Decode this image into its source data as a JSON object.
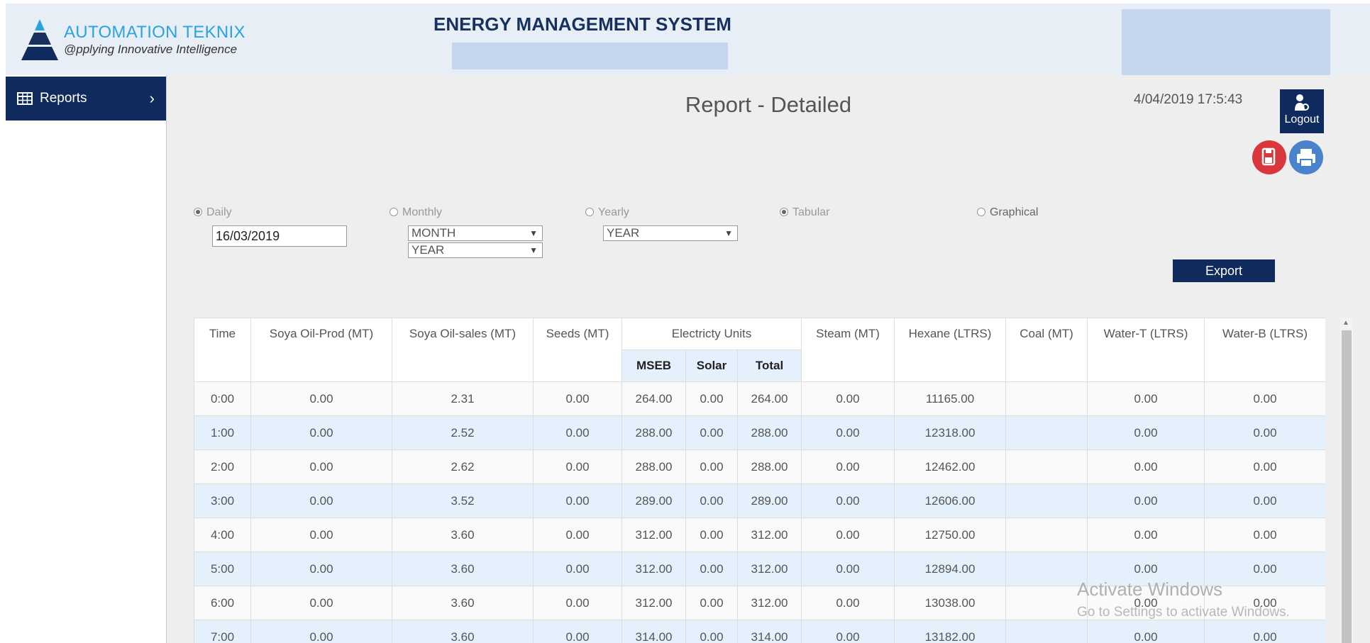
{
  "header": {
    "brand_name": "AUTOMATION TEKNIX",
    "brand_tagline": "@pplying Innovative Intelligence",
    "app_title": "ENERGY MANAGEMENT SYSTEM"
  },
  "sidebar": {
    "items": [
      {
        "label": "Reports",
        "icon": "table-icon",
        "chevron": "›"
      }
    ]
  },
  "main": {
    "page_title": "Report - Detailed",
    "datetime": "4/04/2019 17:5:43",
    "logout_label": "Logout",
    "filters": {
      "daily_label": "Daily",
      "daily_value": "16/03/2019",
      "monthly_label": "Monthly",
      "monthly_month": "MONTH",
      "monthly_year": "YEAR",
      "yearly_label": "Yearly",
      "yearly_year": "YEAR",
      "tabular_label": "Tabular",
      "graphical_label": "Graphical"
    },
    "export_label": "Export",
    "table": {
      "headers": {
        "time": "Time",
        "soya_prod": "Soya Oil-Prod (MT)",
        "soya_sales": "Soya Oil-sales (MT)",
        "seeds": "Seeds (MT)",
        "electricity": "Electricty Units",
        "mseb": "MSEB",
        "solar": "Solar",
        "total": "Total",
        "steam": "Steam (MT)",
        "hexane": "Hexane (LTRS)",
        "coal": "Coal (MT)",
        "water_t": "Water-T (LTRS)",
        "water_b": "Water-B (LTRS)"
      },
      "rows": [
        [
          "0:00",
          "0.00",
          "2.31",
          "0.00",
          "264.00",
          "0.00",
          "264.00",
          "0.00",
          "11165.00",
          "",
          "0.00",
          "0.00"
        ],
        [
          "1:00",
          "0.00",
          "2.52",
          "0.00",
          "288.00",
          "0.00",
          "288.00",
          "0.00",
          "12318.00",
          "",
          "0.00",
          "0.00"
        ],
        [
          "2:00",
          "0.00",
          "2.62",
          "0.00",
          "288.00",
          "0.00",
          "288.00",
          "0.00",
          "12462.00",
          "",
          "0.00",
          "0.00"
        ],
        [
          "3:00",
          "0.00",
          "3.52",
          "0.00",
          "289.00",
          "0.00",
          "289.00",
          "0.00",
          "12606.00",
          "",
          "0.00",
          "0.00"
        ],
        [
          "4:00",
          "0.00",
          "3.60",
          "0.00",
          "312.00",
          "0.00",
          "312.00",
          "0.00",
          "12750.00",
          "",
          "0.00",
          "0.00"
        ],
        [
          "5:00",
          "0.00",
          "3.60",
          "0.00",
          "312.00",
          "0.00",
          "312.00",
          "0.00",
          "12894.00",
          "",
          "0.00",
          "0.00"
        ],
        [
          "6:00",
          "0.00",
          "3.60",
          "0.00",
          "312.00",
          "0.00",
          "312.00",
          "0.00",
          "13038.00",
          "",
          "0.00",
          "0.00"
        ],
        [
          "7:00",
          "0.00",
          "3.60",
          "0.00",
          "314.00",
          "0.00",
          "314.00",
          "0.00",
          "13182.00",
          "",
          "0.00",
          "0.00"
        ]
      ]
    }
  },
  "watermark": {
    "line1": "Activate Windows",
    "line2": "Go to Settings to activate Windows."
  },
  "colors": {
    "navy": "#0f2a5c",
    "accent_blue": "#2aa3e0",
    "row_alt": "#e4f0fb",
    "pdf_red": "#d9373b",
    "print_blue": "#4a83cc"
  }
}
